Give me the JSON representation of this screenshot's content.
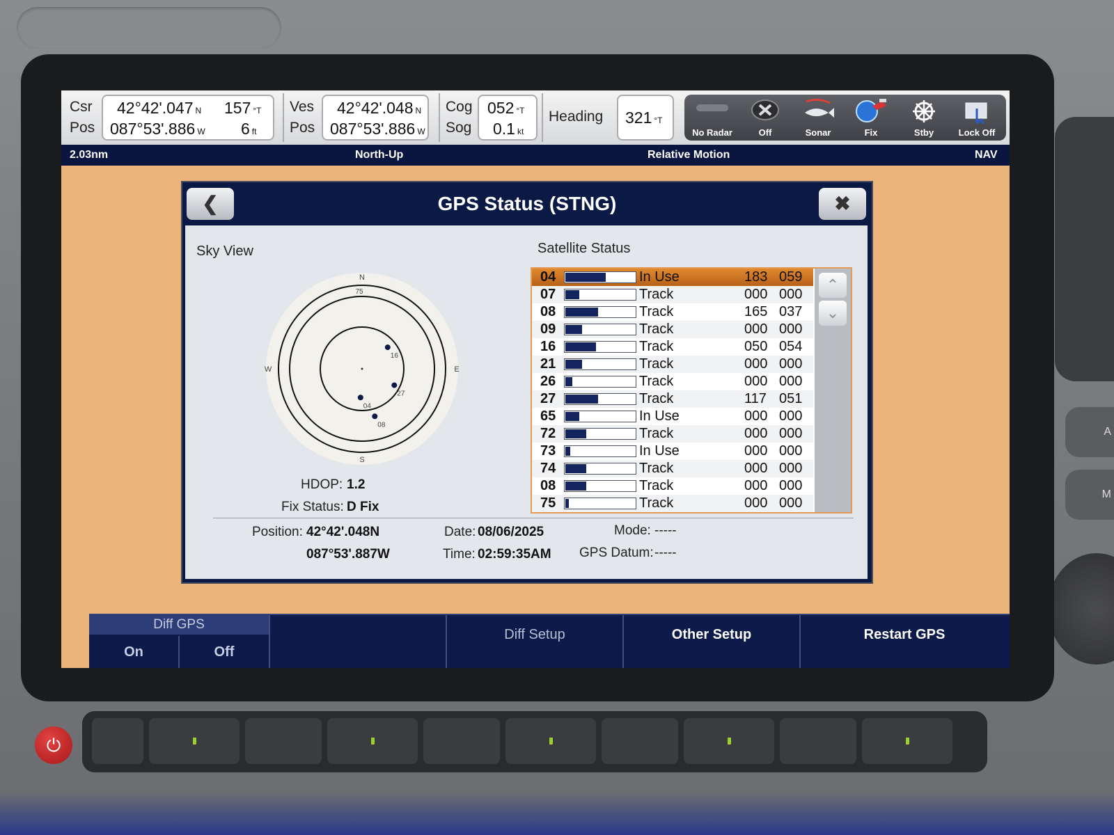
{
  "databar": {
    "csr_label": "Csr",
    "pos_label": "Pos",
    "csr_lat": "42°42'.047",
    "csr_lat_hemi": "N",
    "csr_course": "157",
    "csr_course_unit": "°T",
    "csr_lon": "087°53'.886",
    "csr_lon_hemi": "W",
    "csr_depth": "6",
    "csr_depth_unit": "ft",
    "ves_label": "Ves",
    "ves_pos_label": "Pos",
    "ves_lat": "42°42'.048",
    "ves_lat_hemi": "N",
    "ves_lon": "087°53'.886",
    "ves_lon_hemi": "W",
    "cog_label": "Cog",
    "sog_label": "Sog",
    "cog": "052",
    "cog_unit": "°T",
    "sog": "0.1",
    "sog_unit": "kt",
    "heading_label": "Heading",
    "heading": "321",
    "heading_unit": "°T"
  },
  "iconbar": [
    {
      "label": "No Radar",
      "icon": "radar-icon"
    },
    {
      "label": "Off",
      "icon": "x-circle-icon"
    },
    {
      "label": "Sonar",
      "icon": "fish-icon"
    },
    {
      "label": "Fix",
      "icon": "satellite-icon"
    },
    {
      "label": "Stby",
      "icon": "helm-icon"
    },
    {
      "label": "Lock Off",
      "icon": "touch-lock-icon"
    }
  ],
  "strip": {
    "range": "2.03nm",
    "orientation": "North-Up",
    "motion": "Relative Motion",
    "mode": "NAV"
  },
  "dialog": {
    "title": "GPS Status (STNG)",
    "back_icon": "chevron-left-icon",
    "close_icon": "close-icon",
    "sky_view_title": "Sky View",
    "satellite_status_title": "Satellite Status",
    "hdop_label": "HDOP:",
    "hdop": "1.2",
    "fix_label": "Fix Status:",
    "fix": "D Fix",
    "position_label": "Position:",
    "position_lat": "42°42'.048N",
    "position_lon": "087°53'.887W",
    "date_label": "Date:",
    "date": "08/06/2025",
    "time_label": "Time:",
    "time": "02:59:35AM",
    "mode_label": "Mode:",
    "mode": "-----",
    "datum_label": "GPS Datum:",
    "datum": "-----"
  },
  "sky": {
    "compass": {
      "n": "N",
      "s": "S",
      "e": "E",
      "w": "W"
    },
    "elev_label": "75",
    "satellites": [
      {
        "id": "16",
        "az": 50,
        "el": 54
      },
      {
        "id": "27",
        "az": 117,
        "el": 51
      },
      {
        "id": "04",
        "az": 183,
        "el": 59
      },
      {
        "id": "08",
        "az": 165,
        "el": 37
      }
    ]
  },
  "satellites": [
    {
      "id": "04",
      "signal": 0.58,
      "status": "In Use",
      "az": "183",
      "el": "059",
      "selected": true
    },
    {
      "id": "07",
      "signal": 0.2,
      "status": "Track",
      "az": "000",
      "el": "000"
    },
    {
      "id": "08",
      "signal": 0.47,
      "status": "Track",
      "az": "165",
      "el": "037"
    },
    {
      "id": "09",
      "signal": 0.24,
      "status": "Track",
      "az": "000",
      "el": "000"
    },
    {
      "id": "16",
      "signal": 0.44,
      "status": "Track",
      "az": "050",
      "el": "054"
    },
    {
      "id": "21",
      "signal": 0.24,
      "status": "Track",
      "az": "000",
      "el": "000"
    },
    {
      "id": "26",
      "signal": 0.1,
      "status": "Track",
      "az": "000",
      "el": "000"
    },
    {
      "id": "27",
      "signal": 0.47,
      "status": "Track",
      "az": "117",
      "el": "051"
    },
    {
      "id": "65",
      "signal": 0.2,
      "status": "In Use",
      "az": "000",
      "el": "000"
    },
    {
      "id": "72",
      "signal": 0.3,
      "status": "Track",
      "az": "000",
      "el": "000"
    },
    {
      "id": "73",
      "signal": 0.07,
      "status": "In Use",
      "az": "000",
      "el": "000"
    },
    {
      "id": "74",
      "signal": 0.3,
      "status": "Track",
      "az": "000",
      "el": "000"
    },
    {
      "id": "08",
      "signal": 0.3,
      "status": "Track",
      "az": "000",
      "el": "000"
    },
    {
      "id": "75",
      "signal": 0.05,
      "status": "Track",
      "az": "000",
      "el": "000"
    }
  ],
  "softkeys": {
    "diff_gps": "Diff GPS",
    "on": "On",
    "off": "Off",
    "diff_setup": "Diff Setup",
    "other_setup": "Other Setup",
    "restart_gps": "Restart GPS"
  },
  "side_buttons": [
    "A",
    "M"
  ],
  "colors": {
    "chart_background": "#eab47a",
    "dialog_header": "#0b1a45",
    "selected_row": "#d17a26",
    "signal_bar": "#13245e"
  }
}
